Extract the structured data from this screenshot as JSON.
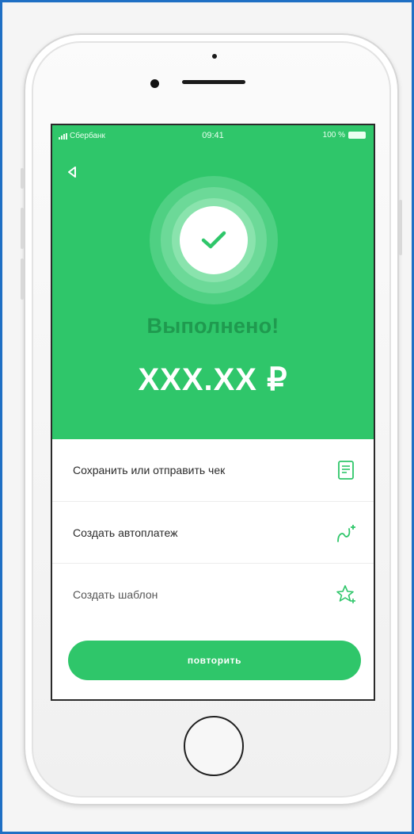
{
  "status_bar": {
    "carrier": "Сбербанк",
    "time": "09:41",
    "battery": "100 %"
  },
  "result": {
    "title": "Выполнено!",
    "amount": "XXX.XX ₽"
  },
  "actions": [
    {
      "label": "Сохранить или отправить чек",
      "icon": "receipt-icon"
    },
    {
      "label": "Создать автоплатеж",
      "icon": "autopay-icon"
    },
    {
      "label": "Создать шаблон",
      "icon": "star-add-icon"
    }
  ],
  "repeat_button": {
    "label": "повторить"
  },
  "colors": {
    "accent": "#2fc66a",
    "title_dark_green": "#1f9a4f",
    "frame_border": "#1f6fc4"
  }
}
